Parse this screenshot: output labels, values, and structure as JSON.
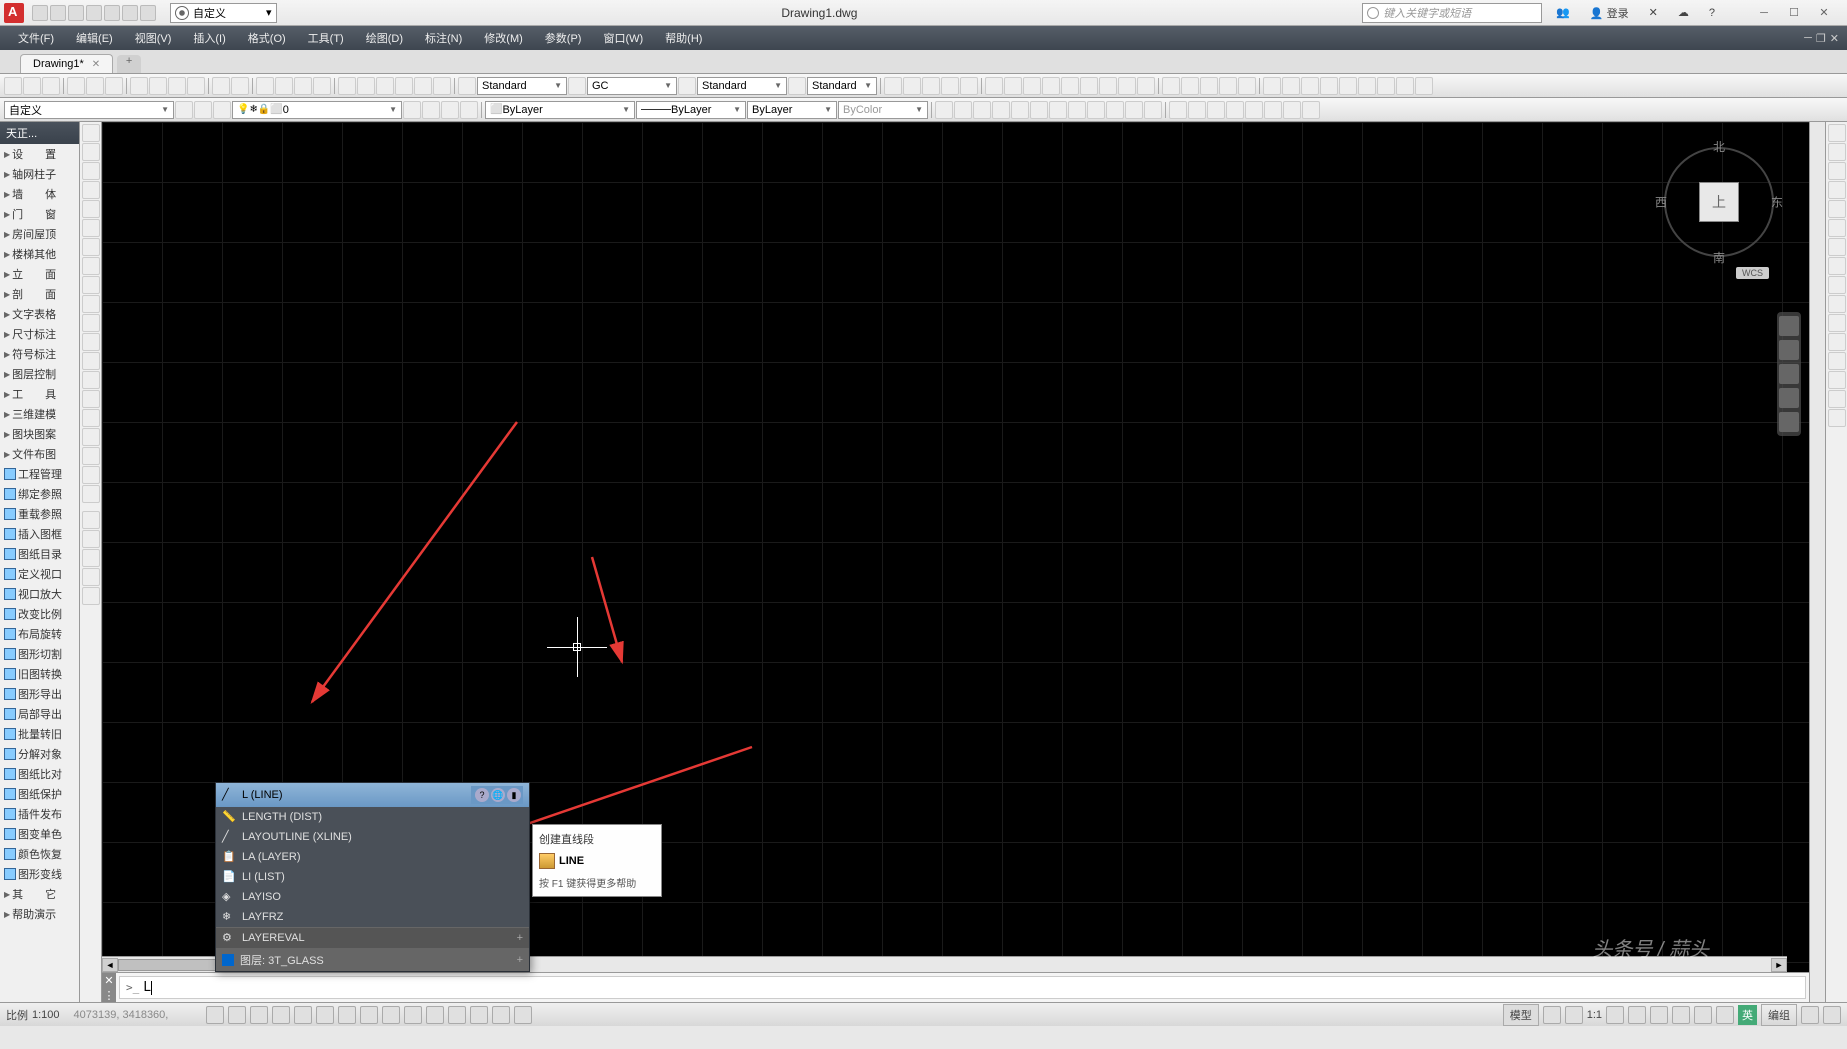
{
  "title": "Drawing1.dwg",
  "workspace": "自定义",
  "search_placeholder": "键入关键字或短语",
  "login": "登录",
  "menubar": [
    "文件(F)",
    "编辑(E)",
    "视图(V)",
    "插入(I)",
    "格式(O)",
    "工具(T)",
    "绘图(D)",
    "标注(N)",
    "修改(M)",
    "参数(P)",
    "窗口(W)",
    "帮助(H)"
  ],
  "doc_tab": "Drawing1*",
  "toolbar2": {
    "workspace": "自定义",
    "layer": "0",
    "textstyle": "Standard",
    "dimstyle": "GC",
    "tablestyle": "Standard",
    "mlstyle": "Standard",
    "bylayer1": "ByLayer",
    "bylayer2": "ByLayer",
    "bylayer3": "ByLayer",
    "bycolor": "ByColor"
  },
  "left_panel": {
    "title": "天正...",
    "groups1": [
      "设　　置",
      "轴网柱子",
      "墙　　体",
      "门　　窗",
      "房间屋顶",
      "楼梯其他",
      "立　　面",
      "剖　　面",
      "文字表格",
      "尺寸标注",
      "符号标注",
      "图层控制",
      "工　　具",
      "三维建模",
      "图块图案",
      "文件布图"
    ],
    "groups2": [
      "工程管理",
      "绑定参照",
      "重载参照"
    ],
    "groups3": [
      "插入图框",
      "图纸目录",
      "定义视口",
      "视口放大",
      "改变比例",
      "布局旋转",
      "图形切割"
    ],
    "groups4": [
      "旧图转换",
      "图形导出",
      "局部导出",
      "批量转旧",
      "分解对象",
      "图纸比对"
    ],
    "groups5": [
      "图纸保护",
      "插件发布"
    ],
    "groups6": [
      "图变单色",
      "颜色恢复",
      "图形变线"
    ],
    "groups7": [
      "其　　它",
      "帮助演示"
    ]
  },
  "viewcube": {
    "face": "上",
    "n": "北",
    "s": "南",
    "e": "东",
    "w": "西",
    "wcs": "WCS"
  },
  "autocomplete": {
    "selected": "L (LINE)",
    "items": [
      "LENGTH (DIST)",
      "LAYOUTLINE (XLINE)",
      "LA (LAYER)",
      "LI (LIST)",
      "LAYISO",
      "LAYFRZ",
      "LAYEREVAL"
    ],
    "layer_item": "图层: 3T_GLASS"
  },
  "tooltip": {
    "title": "创建直线段",
    "cmd": "LINE",
    "help": "按 F1 键获得更多帮助"
  },
  "cmdline": {
    "prompt": ">_",
    "text": "L"
  },
  "statusbar": {
    "scale_label": "比例",
    "scale": "1:100",
    "coords": "4073139, 3418360,",
    "model": "模型",
    "anno": "1:1",
    "ime": "英",
    "grp": "编组"
  },
  "watermark": "头条号 / 蒜头"
}
